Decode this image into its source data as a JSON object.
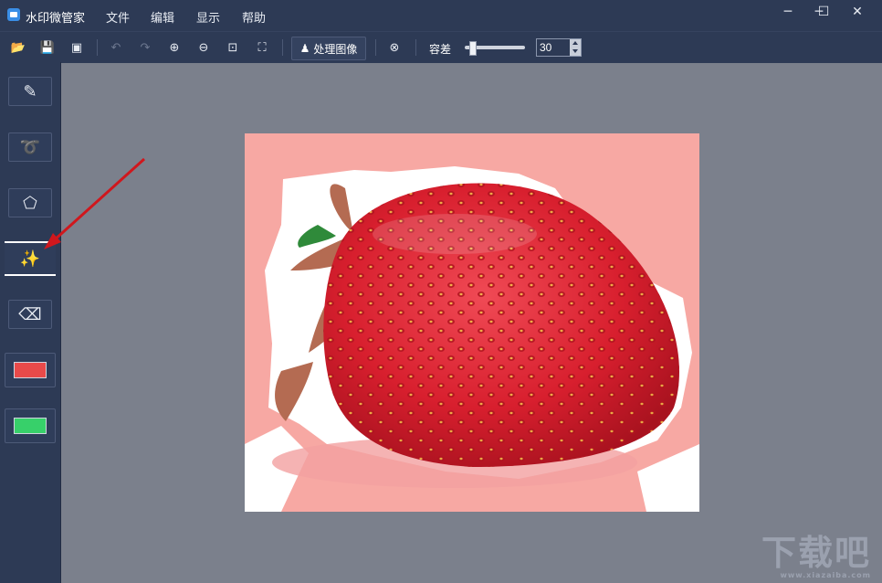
{
  "app": {
    "title": "水印微管家"
  },
  "menu": [
    {
      "label": "文件"
    },
    {
      "label": "编辑"
    },
    {
      "label": "显示"
    },
    {
      "label": "帮助"
    }
  ],
  "window_controls": {
    "pin": "─",
    "minimize": "─",
    "maximize": "☐",
    "close": "✕"
  },
  "toolbar": {
    "open_icon": "📂",
    "save_icon": "💾",
    "save_as_icon": "▣",
    "undo_icon": "↶",
    "redo_icon": "↷",
    "zoom_in_icon": "⊕",
    "zoom_out_icon": "⊖",
    "actual_size_icon": "⊡",
    "fit_icon": "⛶",
    "process_label": "处理图像",
    "process_icon": "♟",
    "clear_icon": "⊗",
    "tolerance_label": "容差",
    "tolerance_value": "30",
    "tolerance_level": 0.08
  },
  "sidebar": {
    "tools": [
      {
        "name": "brush",
        "icon": "✎"
      },
      {
        "name": "lasso",
        "icon": "➰"
      },
      {
        "name": "polygon-select",
        "icon": "⬠"
      },
      {
        "name": "magic-wand",
        "icon": "✨"
      },
      {
        "name": "eraser",
        "icon": "⌫"
      }
    ],
    "colors": {
      "primary": "#e84a4a",
      "secondary": "#37d06a"
    }
  },
  "watermark": {
    "text": "下载吧",
    "sub": "www.xiazaiba.com"
  }
}
